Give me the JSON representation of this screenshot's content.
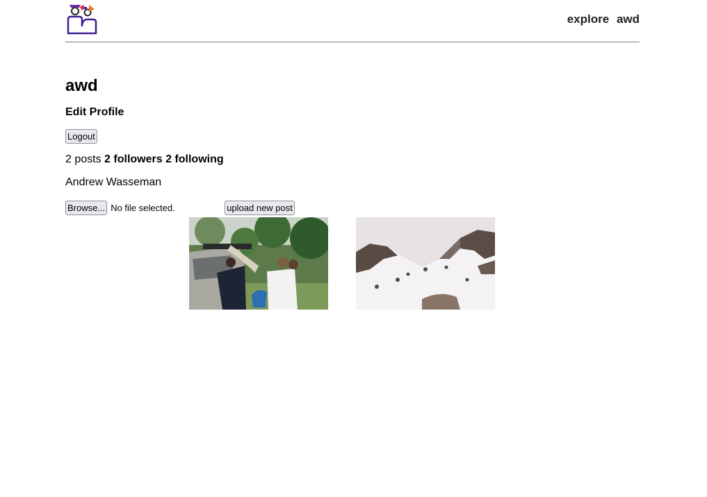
{
  "nav": {
    "explore_label": "explore",
    "user_label": "awd"
  },
  "profile": {
    "username": "awd",
    "edit_label": "Edit Profile",
    "logout_label": "Logout",
    "posts_text": "2 posts",
    "followers_text": "2 followers",
    "following_text": "2 following",
    "full_name": "Andrew Wasseman"
  },
  "upload": {
    "browse_label": "Browse...",
    "file_status": "No file selected.",
    "submit_label": "upload new post"
  },
  "colors": {
    "logo_purple": "#3a1d8f",
    "logo_orange": "#e8742a",
    "logo_red": "#d42a4a",
    "divider": "#7a7a7a"
  }
}
